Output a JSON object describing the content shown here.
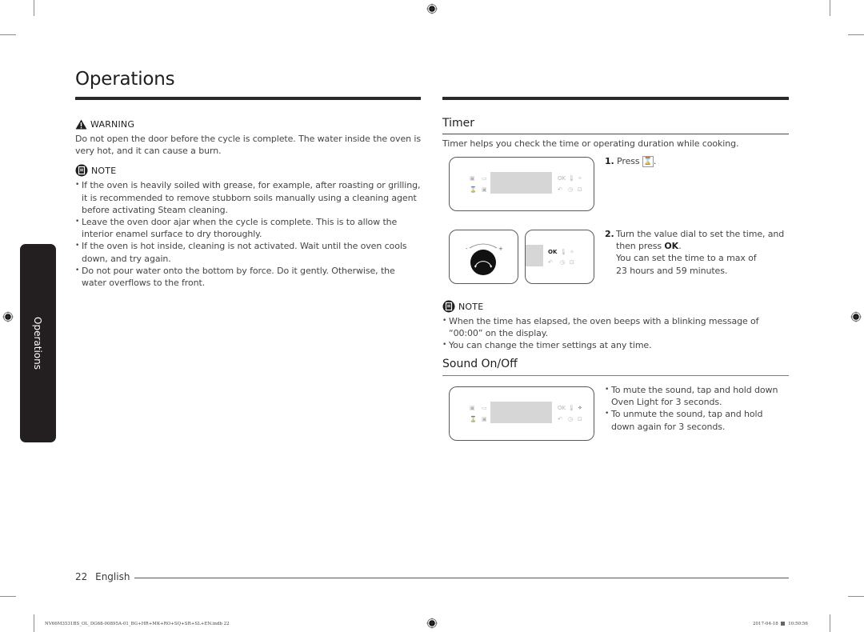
{
  "page": {
    "title": "Operations",
    "side_tab": "Operations",
    "page_number": "22",
    "language": "English"
  },
  "left": {
    "warning": {
      "icon": "warning-triangle-icon",
      "label": "WARNING",
      "text": "Do not open the door before the cycle is complete. The water inside the oven is very hot, and it can cause a burn."
    },
    "note": {
      "icon": "note-icon",
      "label": "NOTE",
      "items": [
        "If the oven is heavily soiled with grease, for example, after roasting or grilling, it is recommended to remove stubborn soils manually using a cleaning agent before activating Steam cleaning.",
        "Leave the oven door ajar when the cycle is complete. This is to allow the interior enamel surface to dry thoroughly.",
        "If the oven is hot inside, cleaning is not activated. Wait until the oven cools down, and try again.",
        "Do not pour water onto the bottom by force. Do it gently. Otherwise, the water overflows to the front."
      ]
    }
  },
  "timer": {
    "title": "Timer",
    "intro": "Timer helps you check the time or operating duration while cooking.",
    "step1": {
      "num": "1.",
      "text": "Press",
      "icon": "hourglass-icon",
      "suffix": "."
    },
    "step2": {
      "num": "2.",
      "line1": "Turn the value dial to set the time, and",
      "line2_pre": "then press ",
      "line2_bold": "OK",
      "line2_post": ".",
      "line3": "You can set the time to a max of",
      "line4": "23 hours and 59 minutes."
    },
    "note": {
      "icon": "note-icon",
      "label": "NOTE",
      "items": [
        "When the time has elapsed, the oven beeps with a blinking message of “00:00” on the display.",
        "You can change the timer settings at any time."
      ]
    }
  },
  "sound": {
    "title": "Sound On/Off",
    "items": [
      "To mute the sound, tap and hold down Oven Light for 3 seconds.",
      "To unmute the sound, tap and hold down again for 3 seconds."
    ]
  },
  "panel_labels": {
    "ok": "OK",
    "dial_minus": "-",
    "dial_plus": "+"
  },
  "print_slug": {
    "file": "NV66M3531BS_OL_DG68-00895A-01_BG+HR+MK+RO+SQ+SR+SL+EN.indb   22",
    "date": "2017-04-18",
    "time": "10:50:56"
  }
}
